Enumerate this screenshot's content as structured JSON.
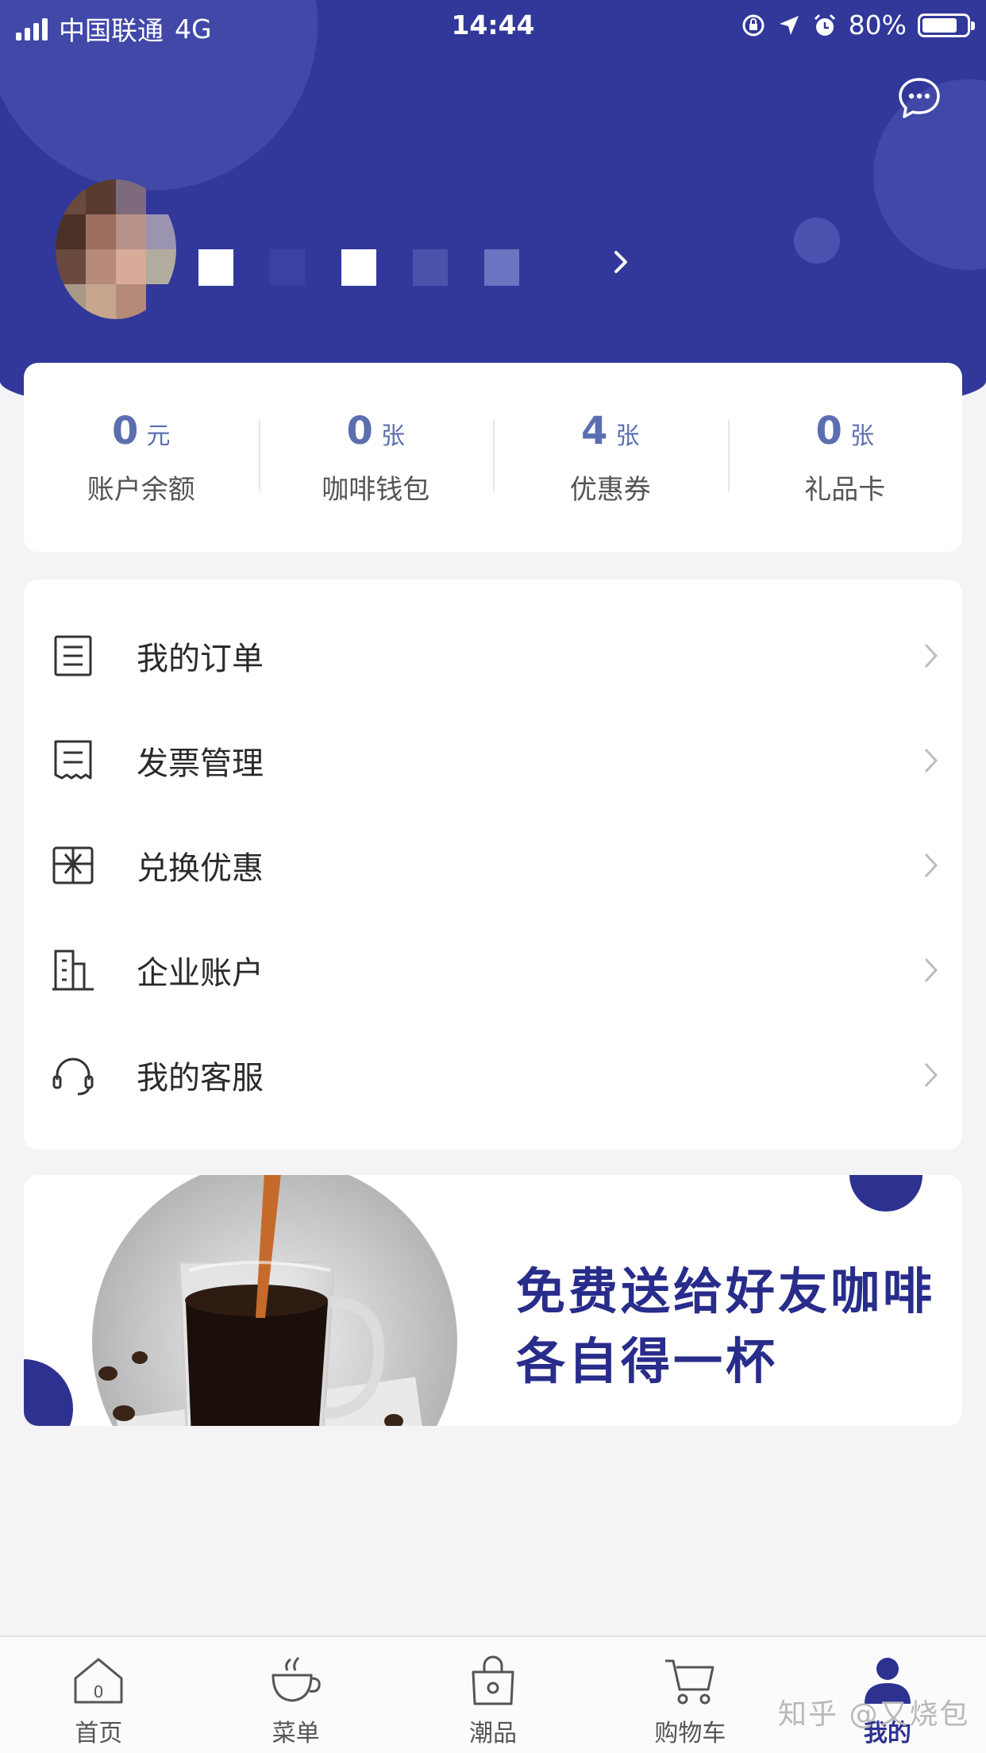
{
  "status_bar": {
    "carrier": "中国联通",
    "network": "4G",
    "time": "14:44",
    "battery": "80%",
    "battery_level": 0.8
  },
  "header": {
    "background_color": "#31389a",
    "chat_icon": "chat-bubble-icon",
    "profile_arrow_icon": "chevron-right-icon"
  },
  "stats": [
    {
      "value": "0",
      "unit": "元",
      "label": "账户余额"
    },
    {
      "value": "0",
      "unit": "张",
      "label": "咖啡钱包"
    },
    {
      "value": "4",
      "unit": "张",
      "label": "优惠券"
    },
    {
      "value": "0",
      "unit": "张",
      "label": "礼品卡"
    }
  ],
  "menu": [
    {
      "label": "我的订单",
      "icon": "order-list-icon"
    },
    {
      "label": "发票管理",
      "icon": "receipt-icon"
    },
    {
      "label": "兑换优惠",
      "icon": "gift-icon"
    },
    {
      "label": "企业账户",
      "icon": "building-icon"
    },
    {
      "label": "我的客服",
      "icon": "headset-icon"
    }
  ],
  "banner": {
    "line1": "免费送给好友咖啡",
    "line2": "各自得一杯",
    "accent_color": "#282c8a"
  },
  "tabbar": [
    {
      "label": "首页",
      "icon": "home-icon",
      "active": false
    },
    {
      "label": "菜单",
      "icon": "coffee-cup-icon",
      "active": false
    },
    {
      "label": "潮品",
      "icon": "shopping-bag-icon",
      "active": false
    },
    {
      "label": "购物车",
      "icon": "cart-icon",
      "active": false
    },
    {
      "label": "我的",
      "icon": "profile-icon",
      "active": true
    }
  ],
  "watermark": "知乎 @又烧包"
}
